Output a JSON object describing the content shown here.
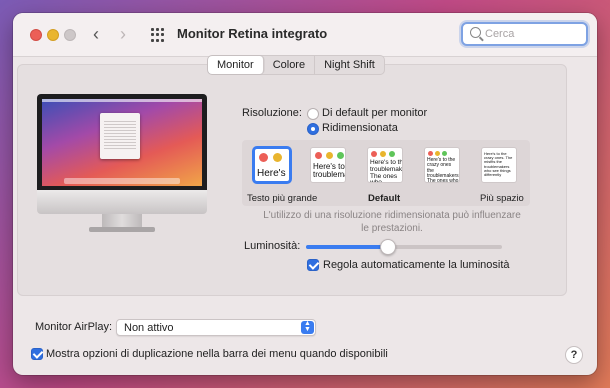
{
  "window": {
    "title": "Monitor Retina integrato",
    "search_placeholder": "Cerca",
    "nav_back_icon": "chevron-left-icon",
    "nav_forward_icon": "chevron-right-icon",
    "grid_icon": "show-all-grid-icon"
  },
  "tabs": [
    {
      "label": "Monitor",
      "active": true
    },
    {
      "label": "Colore",
      "active": false
    },
    {
      "label": "Night Shift",
      "active": false
    }
  ],
  "resolution": {
    "label": "Risoluzione:",
    "options": [
      {
        "label": "Di default per monitor",
        "selected": false
      },
      {
        "label": "Ridimensionata",
        "selected": true
      }
    ],
    "thumbnails": [
      {
        "text": "Here's",
        "selected": true
      },
      {
        "text": "Here's to troublemak",
        "selected": false
      },
      {
        "text": "Here's to the troublemakers. The ones who",
        "selected": false
      },
      {
        "text": "Here's to the crazy ones the troublemakers. The ones who see things",
        "selected": false
      },
      {
        "text": "Here's to the crazy ones. The misfits the troublemakers who see things differently",
        "selected": false
      }
    ],
    "scale_left": "Testo più grande",
    "scale_default": "Default",
    "scale_right": "Più spazio",
    "note": "L'utilizzo di una risoluzione ridimensionata può influenzare le prestazioni."
  },
  "brightness": {
    "label": "Luminosità:",
    "level_percent": 42,
    "auto_label": "Regola automaticamente la luminosità",
    "auto_checked": true
  },
  "airplay": {
    "label": "Monitor AirPlay:",
    "value": "Non attivo"
  },
  "mirroring": {
    "label": "Mostra opzioni di duplicazione nella barra dei menu quando disponibili",
    "checked": true
  },
  "help_label": "?",
  "colors": {
    "accent": "#3a7cf0",
    "close": "#ec5f57",
    "minimize": "#e9b52e"
  }
}
